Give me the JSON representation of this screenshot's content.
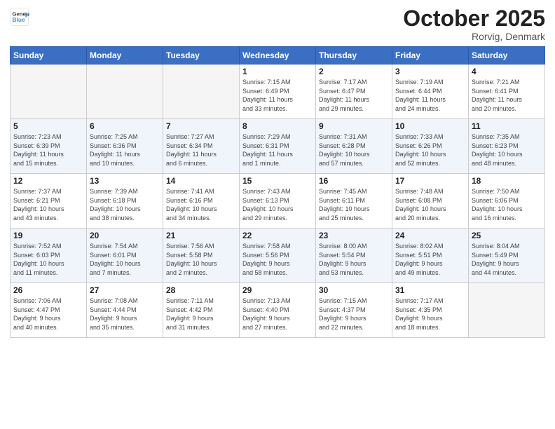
{
  "logo": {
    "line1": "General",
    "line2": "Blue"
  },
  "title": "October 2025",
  "location": "Rorvig, Denmark",
  "weekdays": [
    "Sunday",
    "Monday",
    "Tuesday",
    "Wednesday",
    "Thursday",
    "Friday",
    "Saturday"
  ],
  "weeks": [
    [
      {
        "day": "",
        "info": ""
      },
      {
        "day": "",
        "info": ""
      },
      {
        "day": "",
        "info": ""
      },
      {
        "day": "1",
        "info": "Sunrise: 7:15 AM\nSunset: 6:49 PM\nDaylight: 11 hours\nand 33 minutes."
      },
      {
        "day": "2",
        "info": "Sunrise: 7:17 AM\nSunset: 6:47 PM\nDaylight: 11 hours\nand 29 minutes."
      },
      {
        "day": "3",
        "info": "Sunrise: 7:19 AM\nSunset: 6:44 PM\nDaylight: 11 hours\nand 24 minutes."
      },
      {
        "day": "4",
        "info": "Sunrise: 7:21 AM\nSunset: 6:41 PM\nDaylight: 11 hours\nand 20 minutes."
      }
    ],
    [
      {
        "day": "5",
        "info": "Sunrise: 7:23 AM\nSunset: 6:39 PM\nDaylight: 11 hours\nand 15 minutes."
      },
      {
        "day": "6",
        "info": "Sunrise: 7:25 AM\nSunset: 6:36 PM\nDaylight: 11 hours\nand 10 minutes."
      },
      {
        "day": "7",
        "info": "Sunrise: 7:27 AM\nSunset: 6:34 PM\nDaylight: 11 hours\nand 6 minutes."
      },
      {
        "day": "8",
        "info": "Sunrise: 7:29 AM\nSunset: 6:31 PM\nDaylight: 11 hours\nand 1 minute."
      },
      {
        "day": "9",
        "info": "Sunrise: 7:31 AM\nSunset: 6:28 PM\nDaylight: 10 hours\nand 57 minutes."
      },
      {
        "day": "10",
        "info": "Sunrise: 7:33 AM\nSunset: 6:26 PM\nDaylight: 10 hours\nand 52 minutes."
      },
      {
        "day": "11",
        "info": "Sunrise: 7:35 AM\nSunset: 6:23 PM\nDaylight: 10 hours\nand 48 minutes."
      }
    ],
    [
      {
        "day": "12",
        "info": "Sunrise: 7:37 AM\nSunset: 6:21 PM\nDaylight: 10 hours\nand 43 minutes."
      },
      {
        "day": "13",
        "info": "Sunrise: 7:39 AM\nSunset: 6:18 PM\nDaylight: 10 hours\nand 38 minutes."
      },
      {
        "day": "14",
        "info": "Sunrise: 7:41 AM\nSunset: 6:16 PM\nDaylight: 10 hours\nand 34 minutes."
      },
      {
        "day": "15",
        "info": "Sunrise: 7:43 AM\nSunset: 6:13 PM\nDaylight: 10 hours\nand 29 minutes."
      },
      {
        "day": "16",
        "info": "Sunrise: 7:45 AM\nSunset: 6:11 PM\nDaylight: 10 hours\nand 25 minutes."
      },
      {
        "day": "17",
        "info": "Sunrise: 7:48 AM\nSunset: 6:08 PM\nDaylight: 10 hours\nand 20 minutes."
      },
      {
        "day": "18",
        "info": "Sunrise: 7:50 AM\nSunset: 6:06 PM\nDaylight: 10 hours\nand 16 minutes."
      }
    ],
    [
      {
        "day": "19",
        "info": "Sunrise: 7:52 AM\nSunset: 6:03 PM\nDaylight: 10 hours\nand 11 minutes."
      },
      {
        "day": "20",
        "info": "Sunrise: 7:54 AM\nSunset: 6:01 PM\nDaylight: 10 hours\nand 7 minutes."
      },
      {
        "day": "21",
        "info": "Sunrise: 7:56 AM\nSunset: 5:58 PM\nDaylight: 10 hours\nand 2 minutes."
      },
      {
        "day": "22",
        "info": "Sunrise: 7:58 AM\nSunset: 5:56 PM\nDaylight: 9 hours\nand 58 minutes."
      },
      {
        "day": "23",
        "info": "Sunrise: 8:00 AM\nSunset: 5:54 PM\nDaylight: 9 hours\nand 53 minutes."
      },
      {
        "day": "24",
        "info": "Sunrise: 8:02 AM\nSunset: 5:51 PM\nDaylight: 9 hours\nand 49 minutes."
      },
      {
        "day": "25",
        "info": "Sunrise: 8:04 AM\nSunset: 5:49 PM\nDaylight: 9 hours\nand 44 minutes."
      }
    ],
    [
      {
        "day": "26",
        "info": "Sunrise: 7:06 AM\nSunset: 4:47 PM\nDaylight: 9 hours\nand 40 minutes."
      },
      {
        "day": "27",
        "info": "Sunrise: 7:08 AM\nSunset: 4:44 PM\nDaylight: 9 hours\nand 35 minutes."
      },
      {
        "day": "28",
        "info": "Sunrise: 7:11 AM\nSunset: 4:42 PM\nDaylight: 9 hours\nand 31 minutes."
      },
      {
        "day": "29",
        "info": "Sunrise: 7:13 AM\nSunset: 4:40 PM\nDaylight: 9 hours\nand 27 minutes."
      },
      {
        "day": "30",
        "info": "Sunrise: 7:15 AM\nSunset: 4:37 PM\nDaylight: 9 hours\nand 22 minutes."
      },
      {
        "day": "31",
        "info": "Sunrise: 7:17 AM\nSunset: 4:35 PM\nDaylight: 9 hours\nand 18 minutes."
      },
      {
        "day": "",
        "info": ""
      }
    ]
  ]
}
